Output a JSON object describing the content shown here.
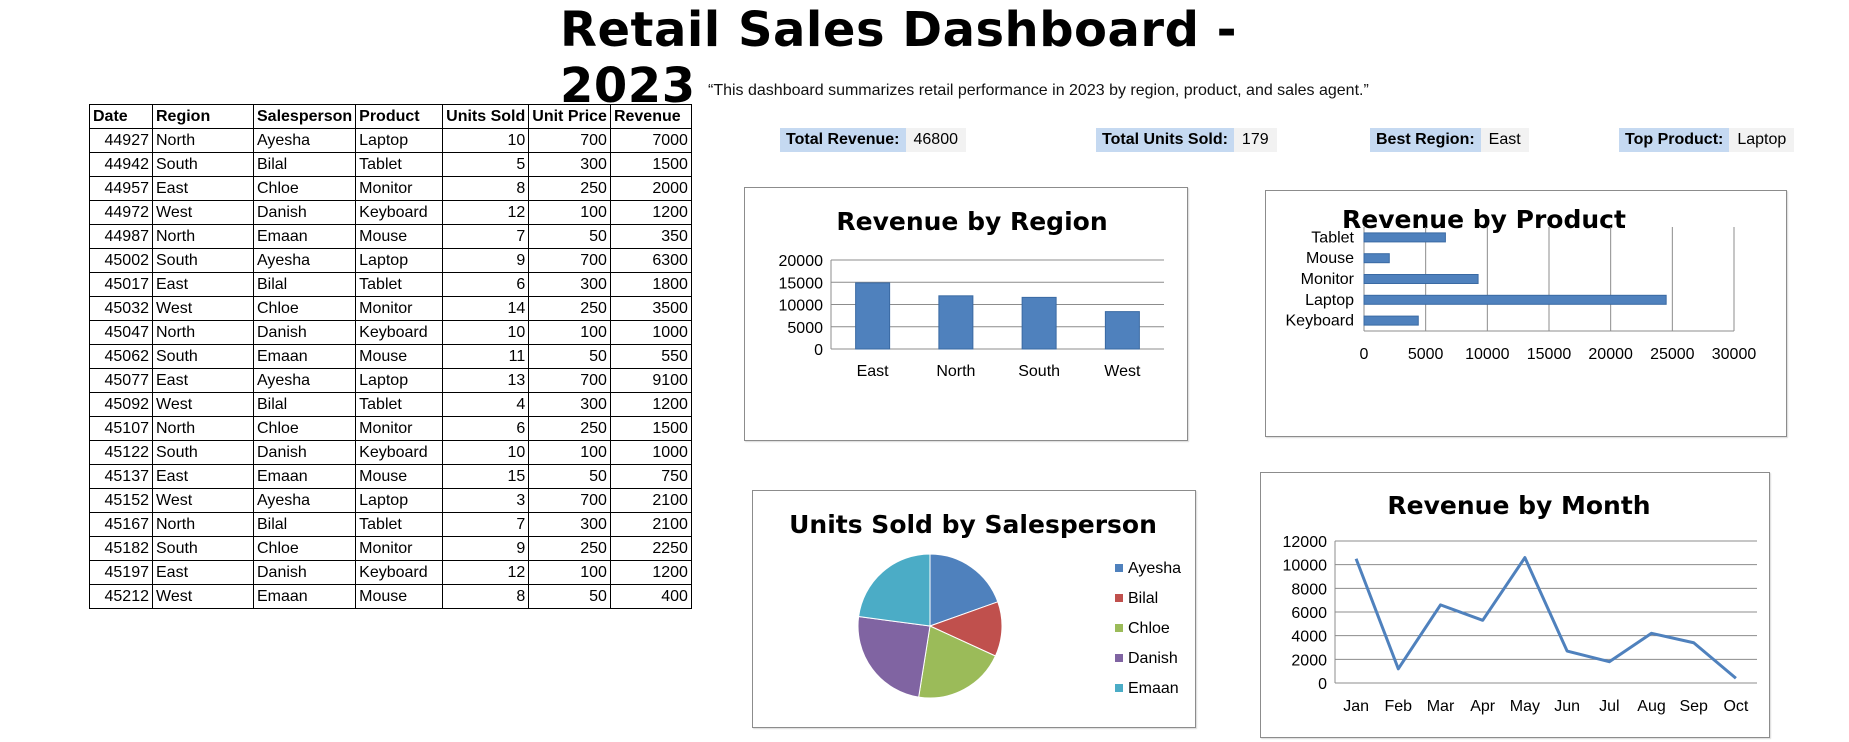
{
  "header": {
    "title": "Retail Sales Dashboard - 2023",
    "subtitle": "“This dashboard summarizes retail performance in 2023 by region, product, and sales agent.”"
  },
  "kpis": [
    {
      "label": "Total Revenue:",
      "value": "46800"
    },
    {
      "label": "Total Units Sold:",
      "value": "179"
    },
    {
      "label": "Best Region:",
      "value": "East"
    },
    {
      "label": "Top Product:",
      "value": "Laptop"
    }
  ],
  "table": {
    "columns": [
      "Date",
      "Region",
      "Salesperson",
      "Product",
      "Units Sold",
      "Unit Price",
      "Revenue"
    ],
    "rows": [
      [
        "44927",
        "North",
        "Ayesha",
        "Laptop",
        "10",
        "700",
        "7000"
      ],
      [
        "44942",
        "South",
        "Bilal",
        "Tablet",
        "5",
        "300",
        "1500"
      ],
      [
        "44957",
        "East",
        "Chloe",
        "Monitor",
        "8",
        "250",
        "2000"
      ],
      [
        "44972",
        "West",
        "Danish",
        "Keyboard",
        "12",
        "100",
        "1200"
      ],
      [
        "44987",
        "North",
        "Emaan",
        "Mouse",
        "7",
        "50",
        "350"
      ],
      [
        "45002",
        "South",
        "Ayesha",
        "Laptop",
        "9",
        "700",
        "6300"
      ],
      [
        "45017",
        "East",
        "Bilal",
        "Tablet",
        "6",
        "300",
        "1800"
      ],
      [
        "45032",
        "West",
        "Chloe",
        "Monitor",
        "14",
        "250",
        "3500"
      ],
      [
        "45047",
        "North",
        "Danish",
        "Keyboard",
        "10",
        "100",
        "1000"
      ],
      [
        "45062",
        "South",
        "Emaan",
        "Mouse",
        "11",
        "50",
        "550"
      ],
      [
        "45077",
        "East",
        "Ayesha",
        "Laptop",
        "13",
        "700",
        "9100"
      ],
      [
        "45092",
        "West",
        "Bilal",
        "Tablet",
        "4",
        "300",
        "1200"
      ],
      [
        "45107",
        "North",
        "Chloe",
        "Monitor",
        "6",
        "250",
        "1500"
      ],
      [
        "45122",
        "South",
        "Danish",
        "Keyboard",
        "10",
        "100",
        "1000"
      ],
      [
        "45137",
        "East",
        "Emaan",
        "Mouse",
        "15",
        "50",
        "750"
      ],
      [
        "45152",
        "West",
        "Ayesha",
        "Laptop",
        "3",
        "700",
        "2100"
      ],
      [
        "45167",
        "North",
        "Bilal",
        "Tablet",
        "7",
        "300",
        "2100"
      ],
      [
        "45182",
        "South",
        "Chloe",
        "Monitor",
        "9",
        "250",
        "2250"
      ],
      [
        "45197",
        "East",
        "Danish",
        "Keyboard",
        "12",
        "100",
        "1200"
      ],
      [
        "45212",
        "West",
        "Emaan",
        "Mouse",
        "8",
        "50",
        "400"
      ]
    ]
  },
  "colors": {
    "bar": "#4f81bd",
    "line": "#4f81bd",
    "kpi_label_bg": "#c5d9f1",
    "pie": [
      "#4f81bd",
      "#c0504d",
      "#9bbb59",
      "#8064a2",
      "#4bacc6"
    ]
  },
  "chart_data": [
    {
      "type": "bar",
      "title": "Revenue by Region",
      "categories": [
        "East",
        "North",
        "South",
        "West"
      ],
      "values": [
        14850,
        11950,
        11600,
        8400
      ],
      "ylim": [
        0,
        20000
      ],
      "yticks": [
        "0",
        "5000",
        "10000",
        "15000",
        "20000"
      ],
      "grid": true,
      "legend": "none"
    },
    {
      "type": "bar",
      "orientation": "horizontal",
      "title": "Revenue by Product",
      "categories": [
        "Tablet",
        "Mouse",
        "Monitor",
        "Laptop",
        "Keyboard"
      ],
      "values": [
        6600,
        2050,
        9250,
        24500,
        4400
      ],
      "xlim": [
        0,
        30000
      ],
      "xticks": [
        "0",
        "5000",
        "10000",
        "15000",
        "20000",
        "25000",
        "30000"
      ],
      "grid": true,
      "legend": "none"
    },
    {
      "type": "pie",
      "title": "Units Sold by Salesperson",
      "labels": [
        "Ayesha",
        "Bilal",
        "Chloe",
        "Danish",
        "Emaan"
      ],
      "values": [
        35,
        22,
        37,
        44,
        41
      ],
      "legend": "right"
    },
    {
      "type": "line",
      "title": "Revenue by Month",
      "categories": [
        "Jan",
        "Feb",
        "Mar",
        "Apr",
        "May",
        "Jun",
        "Jul",
        "Aug",
        "Sep",
        "Oct"
      ],
      "values": [
        10500,
        1200,
        6600,
        5300,
        10600,
        2700,
        1800,
        4200,
        3400,
        400
      ],
      "ylim": [
        0,
        12000
      ],
      "yticks": [
        "0",
        "2000",
        "4000",
        "6000",
        "8000",
        "10000",
        "12000"
      ],
      "grid": true,
      "legend": "none"
    }
  ]
}
